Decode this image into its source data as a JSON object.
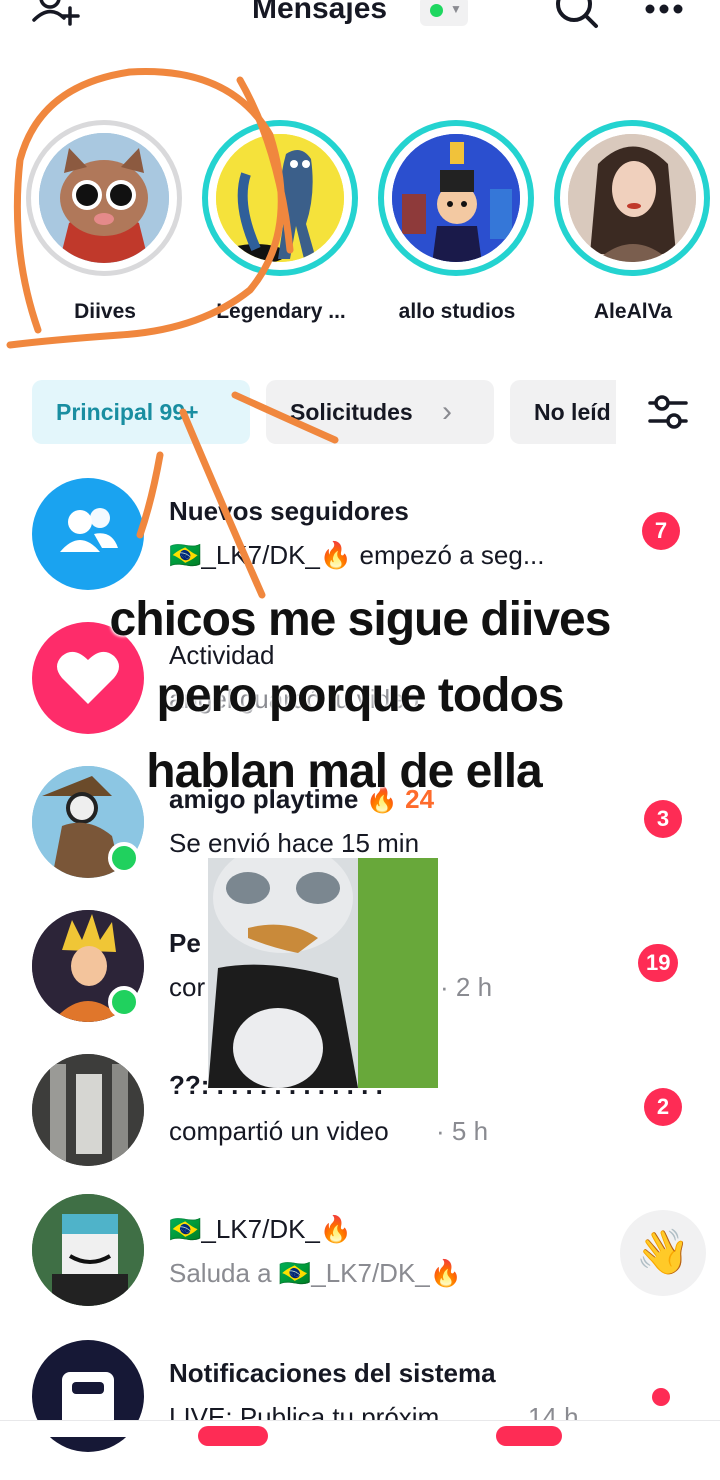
{
  "header": {
    "title": "Mensajes"
  },
  "stories": [
    {
      "name": "Diives"
    },
    {
      "name": "Legendary ..."
    },
    {
      "name": "allo studios"
    },
    {
      "name": "AleAlVa"
    }
  ],
  "filters": {
    "principal": "Principal 99+",
    "solicitudes": "Solicitudes",
    "no_leidos": "No leíd"
  },
  "rows": [
    {
      "title": "Nuevos seguidores",
      "subtitle": "🇧🇷_LK7/DK_🔥 empezó a seg...",
      "badge": "7"
    },
    {
      "title": "Actividad",
      "subtitle": "angel guardó tu video"
    },
    {
      "title": "amigo playtime 🔥",
      "streak": "24",
      "subtitle": "Se envió hace 15 min",
      "badge": "3"
    },
    {
      "title": "Pe",
      "subtitle": "cor",
      "time": "· 2 h",
      "badge": "19"
    },
    {
      "title": "??: . . . . . . . . . . . .",
      "subtitle": "compartió un video",
      "time": "· 5 h",
      "badge": "2"
    },
    {
      "title": "🇧🇷_LK7/DK_🔥",
      "subtitle": "Saluda a 🇧🇷_LK7/DK_🔥",
      "wave": "👋"
    },
    {
      "title": "Notificaciones del sistema",
      "subtitle": "LIVE: Publica tu próxim...",
      "time": "14 h"
    }
  ],
  "overlay": {
    "line1": "chicos me sigue diives",
    "line2": "pero porque todos",
    "line3": "hablan mal de ella"
  },
  "colors": {
    "accent": "#fe2c55",
    "teal_ring": "#24d3d0",
    "online": "#20d15e",
    "annotation": "#f0873e"
  }
}
